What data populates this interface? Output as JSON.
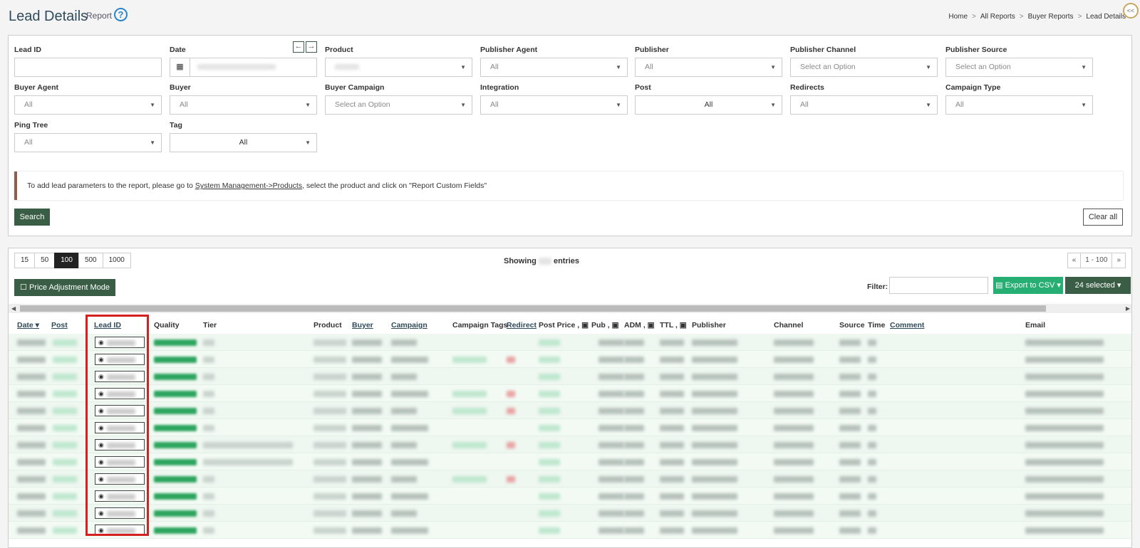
{
  "header": {
    "title": "Lead Details",
    "subtitle": "Report",
    "help_glyph": "?",
    "breadcrumb": [
      "Home",
      "All Reports",
      "Buyer Reports",
      "Lead Details"
    ],
    "breadcrumb_sep": ">",
    "collapse_glyph": "<<"
  },
  "filters": {
    "lead_id": {
      "label": "Lead ID",
      "value": ""
    },
    "date": {
      "label": "Date",
      "prev": "←",
      "next": "→"
    },
    "product": {
      "label": "Product"
    },
    "publisher_agent": {
      "label": "Publisher Agent",
      "value": "All"
    },
    "publisher": {
      "label": "Publisher",
      "value": "All"
    },
    "publisher_channel": {
      "label": "Publisher Channel",
      "value": "Select an Option"
    },
    "publisher_source": {
      "label": "Publisher Source",
      "value": "Select an Option"
    },
    "buyer_agent": {
      "label": "Buyer Agent",
      "value": "All"
    },
    "buyer": {
      "label": "Buyer",
      "value": "All"
    },
    "buyer_campaign": {
      "label": "Buyer Campaign",
      "value": "Select an Option"
    },
    "integration": {
      "label": "Integration",
      "value": "All"
    },
    "post": {
      "label": "Post",
      "value": "All"
    },
    "redirects": {
      "label": "Redirects",
      "value": "All"
    },
    "campaign_type": {
      "label": "Campaign Type",
      "value": "All"
    },
    "ping_tree": {
      "label": "Ping Tree",
      "value": "All"
    },
    "tag": {
      "label": "Tag",
      "value": "All"
    }
  },
  "notice": {
    "before": "To add lead parameters to the report, please go to ",
    "link": "System Management->Products",
    "after": ", select the product and click on \"Report Custom Fields\""
  },
  "buttons": {
    "search": "Search",
    "clear_all": "Clear all",
    "price_adjustment": "Price Adjustment Mode",
    "export": "Export to CSV",
    "selected": "24 selected"
  },
  "pager": {
    "sizes": [
      "15",
      "50",
      "100",
      "500",
      "1000"
    ],
    "active": "100",
    "first": "«",
    "range": "1 - 100",
    "last": "»"
  },
  "showing": {
    "before": "Showing",
    "after": "entries"
  },
  "filter_label": "Filter:",
  "columns": [
    "Date",
    "Post",
    "Lead ID",
    "Quality",
    "Tier",
    "Product",
    "Buyer",
    "Campaign",
    "Campaign Tags",
    "Redirect",
    "Post Price ,",
    "Pub ,",
    "ADM ,",
    "TTL ,",
    "Publisher",
    "Channel",
    "Source",
    "Time",
    "Comment",
    "Email"
  ],
  "colors": {
    "accent": "#3a5e45",
    "export": "#27ae72",
    "highlight": "#d61f1f",
    "help": "#2a86c9"
  },
  "icons": {
    "calendar": "calendar-icon",
    "eye": "eye-icon",
    "caret": "caret-down-icon",
    "help": "help-icon"
  }
}
